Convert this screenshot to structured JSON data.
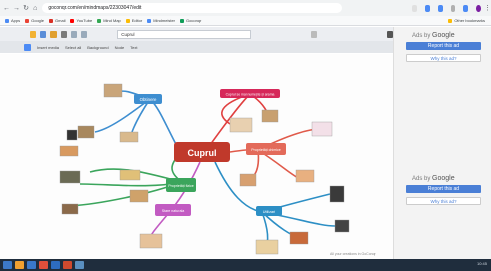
{
  "browser": {
    "url": "goconqr.com/en/mindmaps/22303047/edit",
    "bookmarks": [
      "Apps",
      "Google",
      "Gmail",
      "YouTube",
      "Mind Map",
      "Editor",
      "Mindmeister",
      "Goconqr"
    ],
    "bookmarks_right": "Other bookmarks"
  },
  "toolbar": {
    "title_value": "Cuprul",
    "row2": [
      "Insert media",
      "Select all",
      "Background",
      "Node",
      "Text"
    ]
  },
  "mindmap": {
    "center": "Cuprul",
    "nodes": {
      "top": "Cuprul se mai numește și arama",
      "left_top": "Obtinere",
      "right": "Proprietăți chimice",
      "left_mid": "Proprietăți fizice",
      "bottom": "Stare naturala",
      "right_bottom": "Utilizari"
    }
  },
  "sidebar": {
    "ads_by": "Ads by",
    "google": "Google",
    "report": "Report this ad",
    "why": "Why this ad?"
  },
  "footer_note": "All your creations in GoConqr",
  "taskbar": {
    "clock": "10:45"
  }
}
